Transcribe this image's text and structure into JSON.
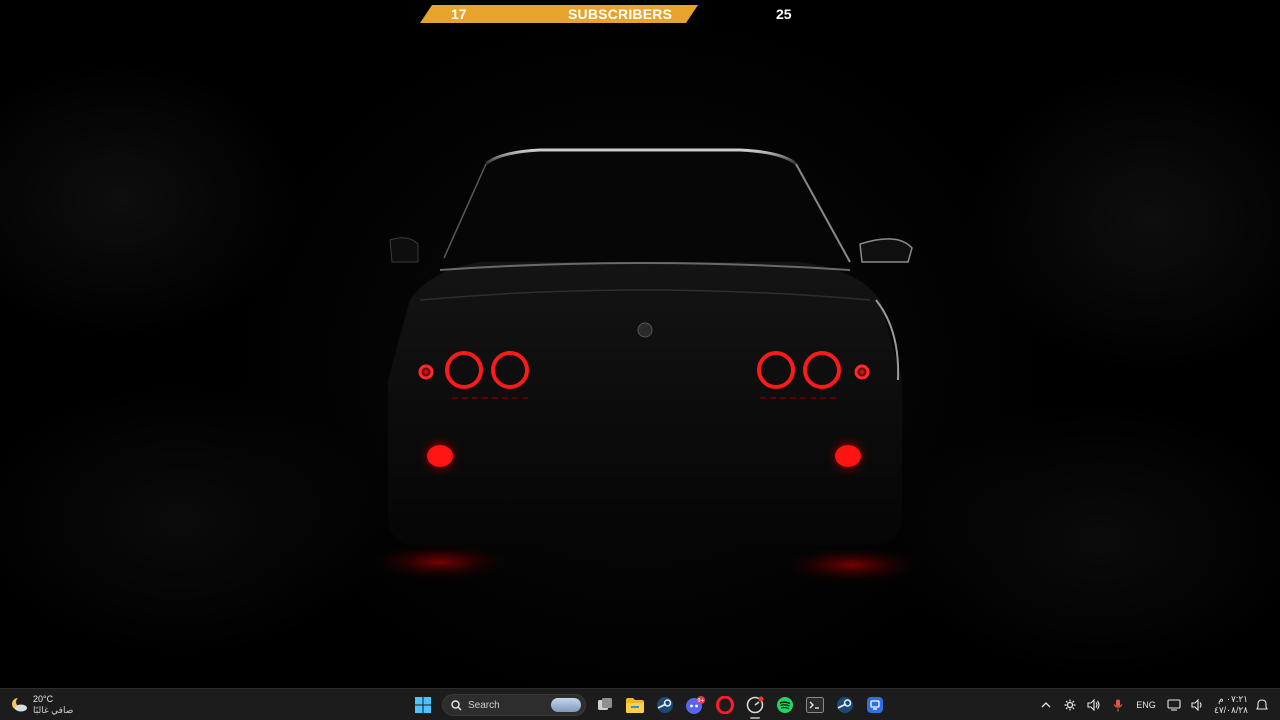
{
  "subscriber_banner": {
    "current": "17",
    "label": "SUBSCRIBERS",
    "goal": "25"
  },
  "taskbar": {
    "weather": {
      "temperature": "20°C",
      "condition": "صافي غالبًا"
    },
    "search": {
      "label": "Search"
    },
    "apps": [
      "start-icon",
      "search-box",
      "task-view-icon",
      "file-explorer-icon",
      "steam-icon",
      "discord-icon",
      "opera-gx-icon",
      "game-capture-icon",
      "spotify-icon",
      "terminal-icon",
      "steam-icon-2",
      "remote-app-icon"
    ],
    "discord_badge": "9+",
    "tray": {
      "language": "ENG",
      "time": "٠٧:٢١ م",
      "date": "٤٧/٠٨/٢٨"
    }
  },
  "colors": {
    "banner": "#e6a52a",
    "taillight": "#ff1a1a",
    "taskbar": "#1c1c1c"
  }
}
